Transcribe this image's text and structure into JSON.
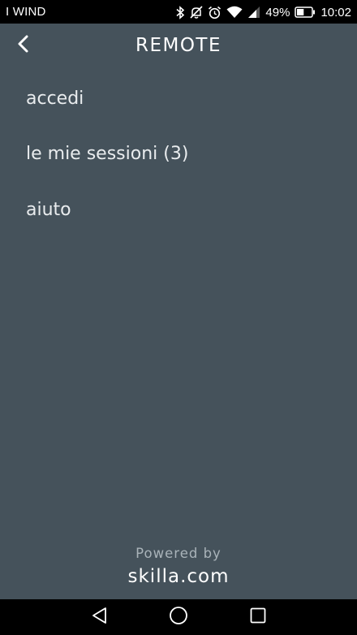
{
  "status_bar": {
    "carrier": "I WIND",
    "icons": [
      "bluetooth-icon",
      "muted-icon",
      "alarm-icon",
      "wifi-icon",
      "signal-icon",
      "battery-icon"
    ],
    "battery_level": 49,
    "battery_text": "49%",
    "time": "10:02"
  },
  "header": {
    "back_icon": "chevron-left-icon",
    "title": "REMOTE"
  },
  "menu": {
    "items": [
      {
        "label": "accedi"
      },
      {
        "label": "le mie sessioni (3)"
      },
      {
        "label": "aiuto"
      }
    ]
  },
  "footer": {
    "powered_by": "Powered by",
    "brand": "skilla.com"
  },
  "nav_bar": {
    "buttons": [
      "back-triangle-icon",
      "home-circle-icon",
      "recents-square-icon"
    ]
  },
  "colors": {
    "background": "#45525b",
    "status_bar": "#000000",
    "text_primary": "#ffffff",
    "text_menu": "#e9ecee",
    "text_muted": "#a9b3b9"
  }
}
